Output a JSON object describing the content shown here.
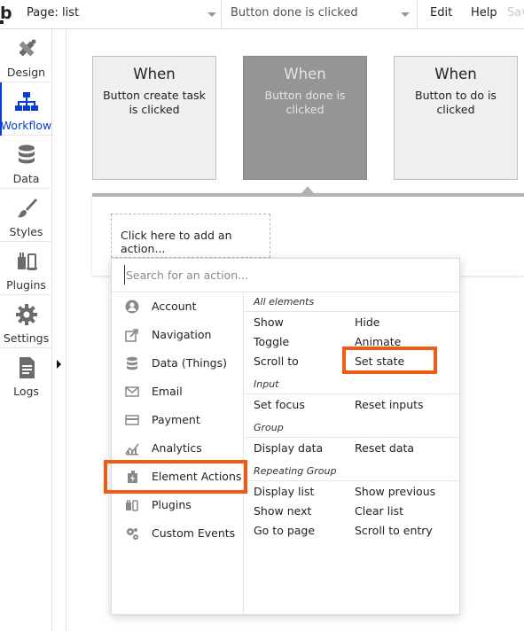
{
  "header": {
    "page_selector": "Page: list",
    "event_selector": "Button done is clicked",
    "menu": [
      "Edit",
      "Help",
      "Save"
    ]
  },
  "sidebar": {
    "items": [
      {
        "label": "Design",
        "icon": "design-icon"
      },
      {
        "label": "Workflow",
        "icon": "workflow-icon",
        "active": true
      },
      {
        "label": "Data",
        "icon": "database-icon"
      },
      {
        "label": "Styles",
        "icon": "brush-icon"
      },
      {
        "label": "Plugins",
        "icon": "plugin-icon"
      },
      {
        "label": "Settings",
        "icon": "gear-icon"
      },
      {
        "label": "Logs",
        "icon": "document-icon"
      }
    ]
  },
  "workflow": {
    "events": [
      {
        "title": "When",
        "description": "Button create task is clicked"
      },
      {
        "title": "When",
        "description": "Button done is clicked",
        "selected": true
      },
      {
        "title": "When",
        "description": "Button to do is clicked"
      }
    ],
    "add_action_label": "Click here to add an action..."
  },
  "action_menu": {
    "search_placeholder": "Search for an action...",
    "categories": [
      {
        "label": "Account",
        "icon": "account-icon"
      },
      {
        "label": "Navigation",
        "icon": "navigation-icon"
      },
      {
        "label": "Data (Things)",
        "icon": "database-icon"
      },
      {
        "label": "Email",
        "icon": "email-icon"
      },
      {
        "label": "Payment",
        "icon": "credit-card-icon"
      },
      {
        "label": "Analytics",
        "icon": "analytics-icon"
      },
      {
        "label": "Element Actions",
        "icon": "element-actions-icon",
        "highlighted": true
      },
      {
        "label": "Plugins",
        "icon": "plugin-icon"
      },
      {
        "label": "Custom Events",
        "icon": "gears-icon"
      }
    ],
    "groups": {
      "all_elements": {
        "title": "All elements",
        "actions": [
          "Show",
          "Hide",
          "Toggle",
          "Animate",
          "Scroll to",
          "Set state"
        ]
      },
      "input": {
        "title": "Input",
        "actions": [
          "Set focus",
          "Reset inputs"
        ]
      },
      "group": {
        "title": "Group",
        "actions": [
          "Display data",
          "Reset data"
        ]
      },
      "repeating_group": {
        "title": "Repeating Group",
        "actions": [
          "Display list",
          "Show previous",
          "Show next",
          "Clear list",
          "Go to page",
          "Scroll to entry"
        ]
      }
    }
  },
  "colors": {
    "accent": "#0a3cdb",
    "highlight": "#f05a14",
    "selected_card": "#959595"
  }
}
